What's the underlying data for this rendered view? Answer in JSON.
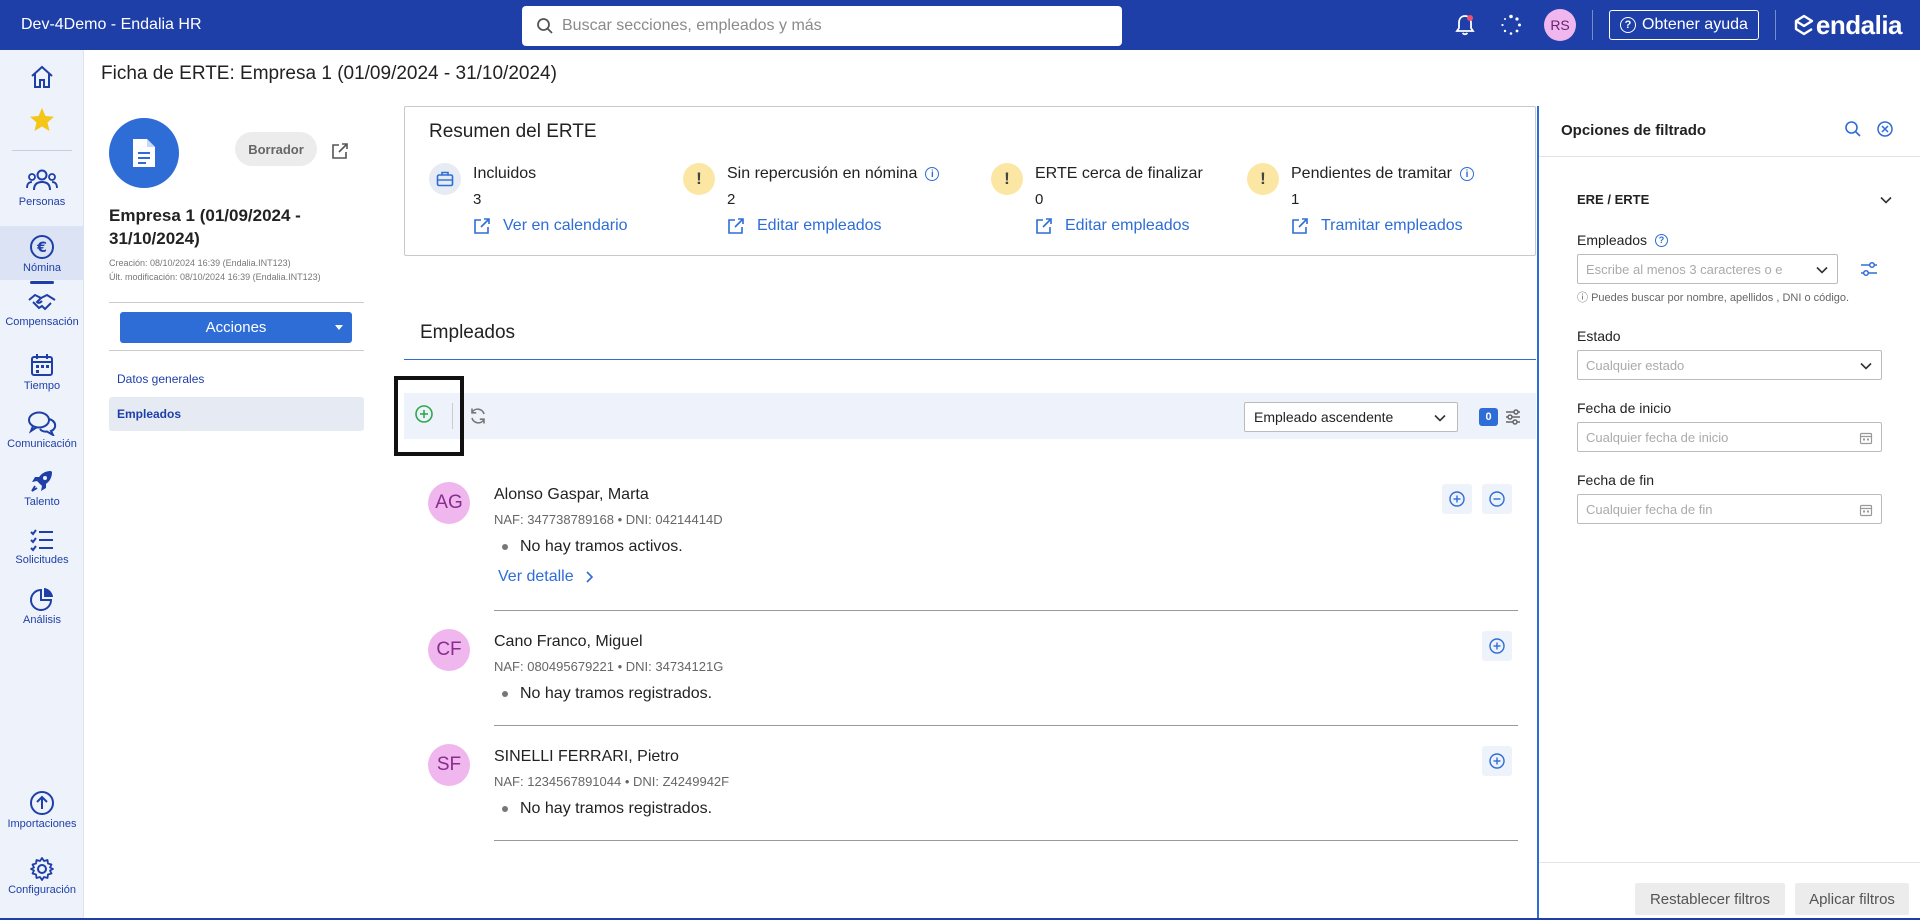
{
  "topbar": {
    "app_title": "Dev-4Demo - Endalia HR",
    "search_placeholder": "Buscar secciones, empleados y más",
    "avatar_initials": "RS",
    "help_label": "Obtener ayuda",
    "brand": "endalia"
  },
  "sidebar": {
    "items": [
      {
        "label": "Personas"
      },
      {
        "label": "Nómina"
      },
      {
        "label": "Compensación"
      },
      {
        "label": "Tiempo"
      },
      {
        "label": "Comunicación"
      },
      {
        "label": "Talento"
      },
      {
        "label": "Solicitudes"
      },
      {
        "label": "Análisis"
      }
    ],
    "bottom_items": [
      {
        "label": "Importaciones"
      },
      {
        "label": "Configuración"
      }
    ]
  },
  "page": {
    "title": "Ficha de ERTE: Empresa 1 (01/09/2024 - 31/10/2024)"
  },
  "left_panel": {
    "status_badge": "Borrador",
    "company_name": "Empresa 1 (01/09/2024 - 31/10/2024)",
    "created": "Creación: 08/10/2024 16:39 (Endalia.INT123)",
    "modified": "Últ. modificación: 08/10/2024 16:39 (Endalia.INT123)",
    "actions_label": "Acciones",
    "links": [
      {
        "label": "Datos generales"
      },
      {
        "label": "Empleados"
      }
    ]
  },
  "summary": {
    "title": "Resumen del ERTE",
    "stats": [
      {
        "title": "Incluidos",
        "value": "3",
        "link": "Ver en calendario"
      },
      {
        "title": "Sin repercusión en nómina",
        "value": "2",
        "link": "Editar empleados"
      },
      {
        "title": "ERTE cerca de finalizar",
        "value": "0",
        "link": "Editar empleados"
      },
      {
        "title": "Pendientes de tramitar",
        "value": "1",
        "link": "Tramitar empleados"
      }
    ]
  },
  "employees": {
    "title": "Empleados",
    "sort_value": "Empleado ascendente",
    "filter_count": "0",
    "rows": [
      {
        "initials": "AG",
        "name": "Alonso Gaspar, Marta",
        "meta": "NAF: 347738789168 • DNI: 04214414D",
        "tramo": "No hay tramos activos.",
        "detail": "Ver detalle"
      },
      {
        "initials": "CF",
        "name": "Cano Franco, Miguel",
        "meta": "NAF: 080495679221 • DNI: 34734121G",
        "tramo": "No hay tramos registrados."
      },
      {
        "initials": "SF",
        "name": "SINELLI FERRARI, Pietro",
        "meta": "NAF: 1234567891044 • DNI: Z4249942F",
        "tramo": "No hay tramos registrados."
      }
    ]
  },
  "filters": {
    "title": "Opciones de filtrado",
    "section": "ERE / ERTE",
    "employees_label": "Empleados",
    "employees_placeholder": "Escribe al menos 3 caracteres o e",
    "employees_hint": "Puedes buscar por nombre, apellidos , DNI o código.",
    "state_label": "Estado",
    "state_placeholder": "Cualquier estado",
    "start_label": "Fecha de inicio",
    "start_placeholder": "Cualquier fecha de inicio",
    "end_label": "Fecha de fin",
    "end_placeholder": "Cualquier fecha de fin",
    "reset_label": "Restablecer filtros",
    "apply_label": "Aplicar filtros"
  },
  "colors": {
    "brand_blue": "#1e3fa8",
    "accent_blue": "#2e6dd6",
    "avatar_pink": "#f0b7ef",
    "warning_yellow": "#fbe7a3"
  }
}
